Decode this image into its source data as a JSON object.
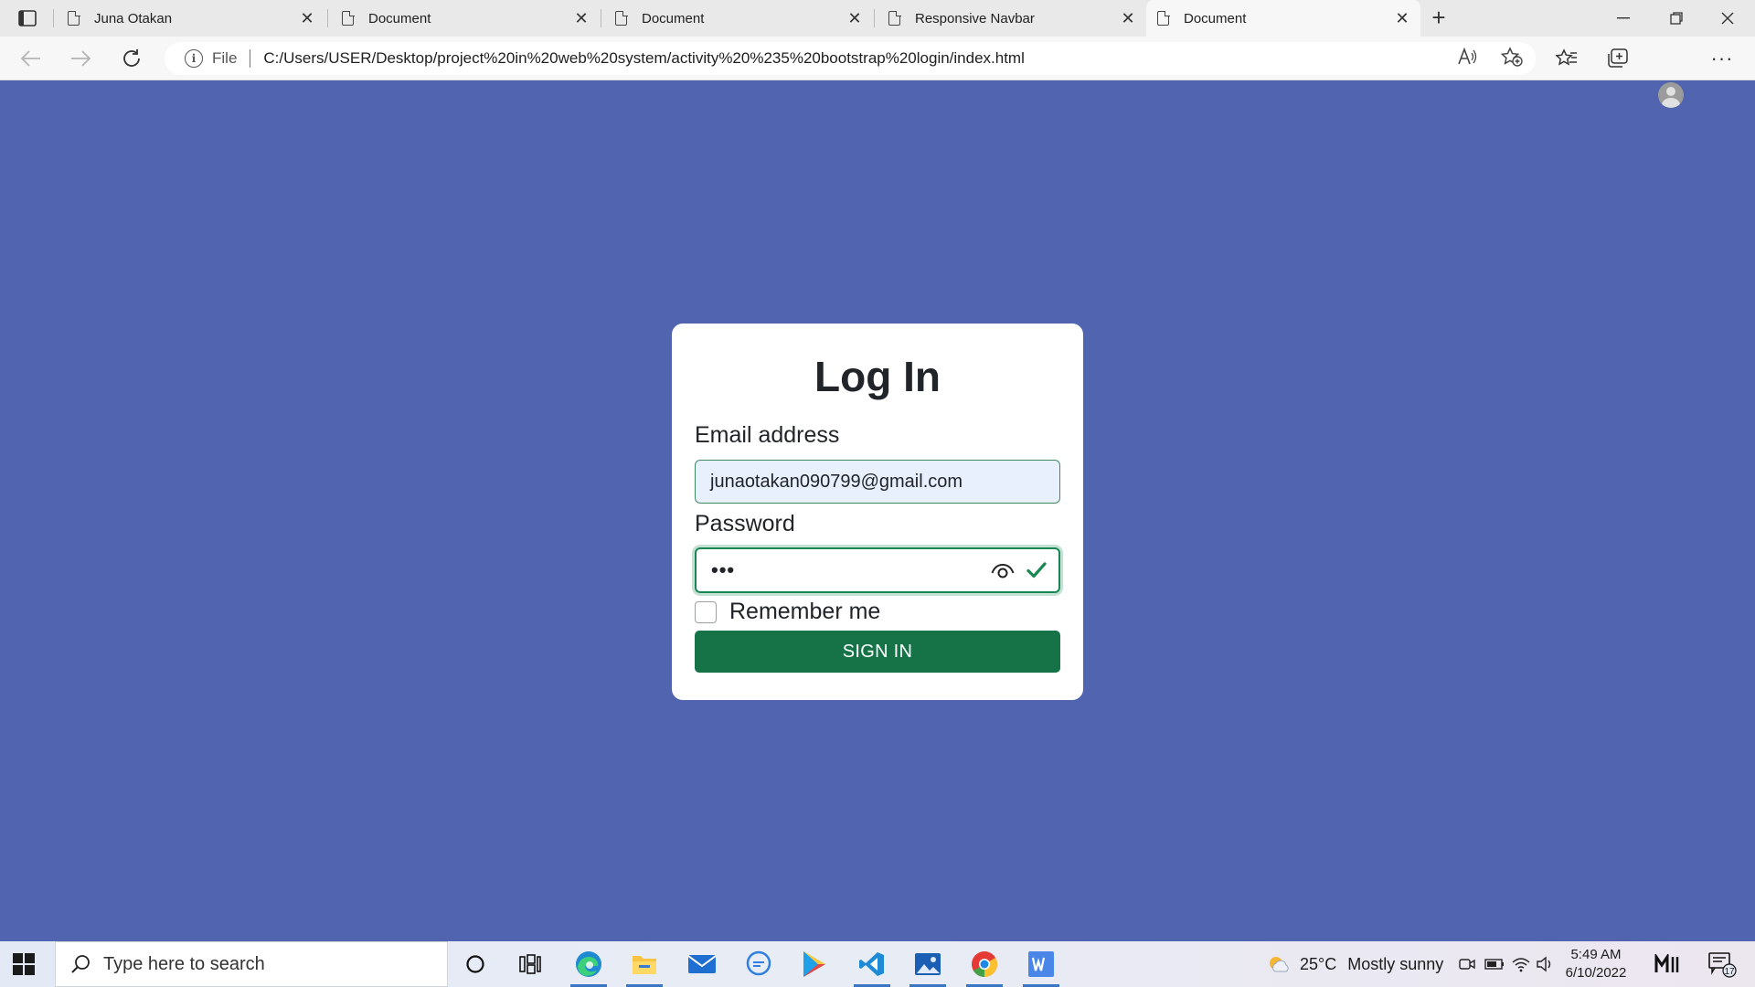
{
  "browser": {
    "tabs": [
      {
        "title": "Juna Otakan",
        "active": false
      },
      {
        "title": "Document",
        "active": false
      },
      {
        "title": "Document",
        "active": false
      },
      {
        "title": "Responsive Navbar",
        "active": false
      },
      {
        "title": "Document",
        "active": true
      }
    ],
    "address": {
      "scheme_label": "File",
      "url": "C:/Users/USER/Desktop/project%20in%20web%20system/activity%20%235%20bootstrap%20login/index.html"
    }
  },
  "login": {
    "title": "Log In",
    "email_label": "Email address",
    "email_value": "junaotakan090799@gmail.com",
    "password_label": "Password",
    "password_value": "•••",
    "remember_label": "Remember me",
    "remember_checked": false,
    "submit_label": "SIGN IN"
  },
  "taskbar": {
    "search_placeholder": "Type here to search",
    "weather_temp": "25°C",
    "weather_desc": "Mostly sunny",
    "time": "5:49 AM",
    "date": "6/10/2022",
    "notification_count": "17"
  },
  "colors": {
    "page_background": "#5064b0",
    "valid_green": "#198754",
    "button_green": "#157347"
  }
}
